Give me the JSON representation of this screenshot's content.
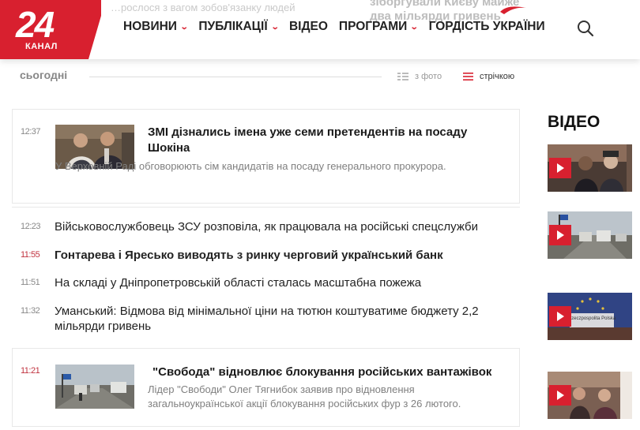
{
  "header": {
    "logo": {
      "number": "24",
      "word": "КАНАЛ"
    },
    "ghost_text": [
      "…рослося з вагом зобов'язанку людей",
      "зіборгували Києву майже",
      "два мільярди гривень"
    ],
    "nav": [
      {
        "label": "НОВИНИ",
        "has_dropdown": true
      },
      {
        "label": "ПУБЛІКАЦІЇ",
        "has_dropdown": true
      },
      {
        "label": "ВІДЕО",
        "has_dropdown": false
      },
      {
        "label": "ПРОГРАМИ",
        "has_dropdown": true
      },
      {
        "label": "ГОРДІСТЬ УКРАЇНИ",
        "has_dropdown": false
      }
    ],
    "search_icon": "search-icon",
    "accent_color": "#d8202f"
  },
  "filters": {
    "today": "сьогодні",
    "with_photo": "з фото",
    "feed": "стрічкою"
  },
  "news": [
    {
      "time": "12:37",
      "title": "ЗМІ дізнались імена уже семи претендентів на посаду Шокіна",
      "lead": "У Верховній Раді обговорюють сім кандидатів на посаду генерального прокурора.",
      "featured": true
    },
    {
      "time": "12:23",
      "title": "Військовослужбовець ЗСУ розповіла, як працювала на російські спецслужби",
      "bold": false
    },
    {
      "time": "11:55",
      "title": "Гонтарева і Яресько виводять з ринку черговий український банк",
      "bold": true,
      "time_red": true
    },
    {
      "time": "11:51",
      "title": "На складі у Дніпропетровській області сталась масштабна пожежа",
      "bold": false
    },
    {
      "time": "11:32",
      "title": "Уманський: Відмова від мінімальної ціни на тютюн коштуватиме бюджету 2,2 мільярди гривень",
      "bold": false
    },
    {
      "time": "11:21",
      "title": "\"Свобода\" відновлює блокування російських вантажівок",
      "lead": "Лідер \"Свободи\" Олег Тягнибок заявив про відновлення загальноукраїнської акції блокування російських фур з 26 лютого.",
      "featured": true,
      "time_red": true
    }
  ],
  "video": {
    "heading": "ВІДЕО",
    "thumb_text": "Rzeczpospolita Polska"
  }
}
